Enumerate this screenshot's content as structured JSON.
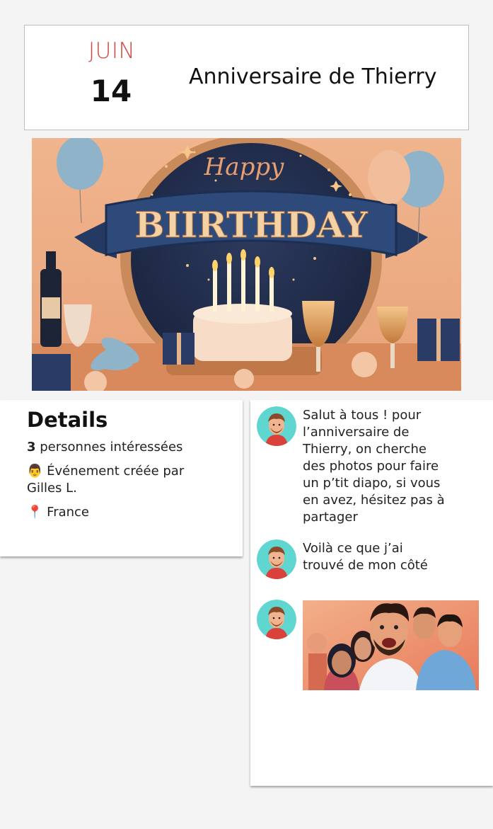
{
  "event": {
    "month": "JUIN",
    "day": "14",
    "title": "Anniversaire de Thierry"
  },
  "banner": {
    "happy_text": "Happy",
    "birthday_text": "BIIRTHDAY"
  },
  "details": {
    "title": "Details",
    "interested_count": "3",
    "interested_text": " personnes intéressées",
    "creator_emoji": "👨",
    "creator_text": "Événement créée par Gilles L.",
    "location_emoji": "📍",
    "location_text": "France"
  },
  "chat": {
    "messages": [
      {
        "text": "Salut à tous ! pour l’anniversaire de Thierry, on cherche des photos pour faire un p’tit diapo, si vous en avez, hésitez pas à partager"
      },
      {
        "text": "Voilà ce que j’ai trouvé de mon côté"
      },
      {
        "type": "image"
      }
    ]
  },
  "colors": {
    "accent": "#cf4b42",
    "avatar_bg": "#5fd6cf",
    "ribbon": "#2d4a7a"
  }
}
